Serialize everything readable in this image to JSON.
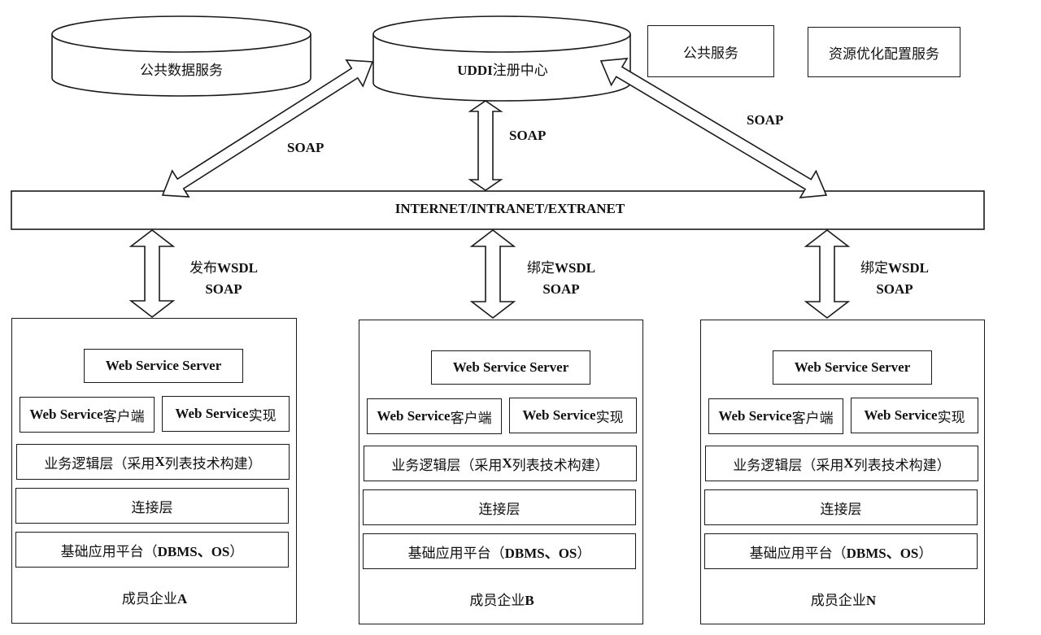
{
  "databases": {
    "public_data": "公共数据服务",
    "uddi_prefix": "UDDI",
    "uddi_suffix": "注册中心"
  },
  "services": {
    "public_service": "公共服务",
    "resource_optimization": "资源优化配置服务"
  },
  "network": {
    "label": "INTERNET/INTRANET/EXTRANET"
  },
  "top_links": {
    "left": "SOAP",
    "center": "SOAP",
    "right": "SOAP"
  },
  "enterprise_links": [
    {
      "action_cn": "发布",
      "action_en": "WSDL",
      "protocol": "SOAP"
    },
    {
      "action_cn": "绑定",
      "action_en": "WSDL",
      "protocol": "SOAP"
    },
    {
      "action_cn": "绑定",
      "action_en": "WSDL",
      "protocol": "SOAP"
    }
  ],
  "enterprise_layers": {
    "server": "Web Service Server",
    "client_en": "Web Service",
    "client_cn": "客户端",
    "impl_en": "Web Service",
    "impl_cn": "实现",
    "business_a": "业务逻辑层（采用",
    "business_x": "X",
    "business_b": "列表技术构建）",
    "connection": "连接层",
    "platform_a": "基础应用平台（",
    "platform_b": "DBMS、OS",
    "platform_c": "）"
  },
  "enterprises": [
    {
      "name_cn": "成员企业",
      "name_id": "A"
    },
    {
      "name_cn": "成员企业",
      "name_id": "B"
    },
    {
      "name_cn": "成员企业",
      "name_id": "N"
    }
  ]
}
